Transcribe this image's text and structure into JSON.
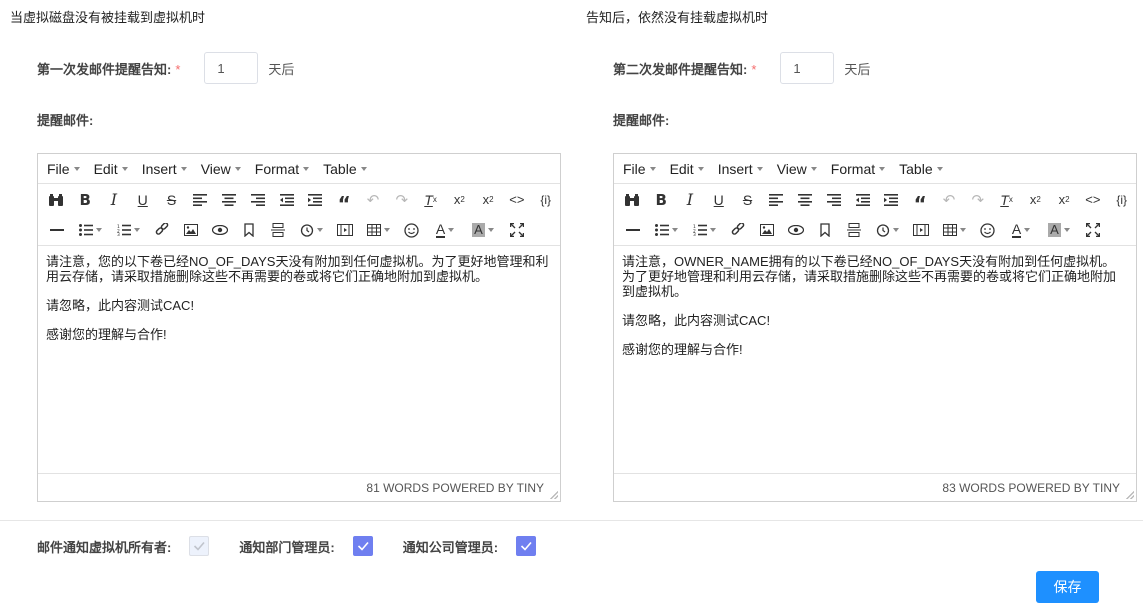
{
  "left": {
    "section_title": "当虚拟磁盘没有被挂载到虚拟机时",
    "reminder_label": "第一次发邮件提醒告知:",
    "required_mark": "*",
    "days_value": "1",
    "days_unit": "天后",
    "mail_label": "提醒邮件:",
    "content": [
      "请注意，您的以下卷已经NO_OF_DAYS天没有附加到任何虚拟机。为了更好地管理和利用云存储，请采取措施删除这些不再需要的卷或将它们正确地附加到虚拟机。",
      "请忽略，此内容测试CAC!",
      "感谢您的理解与合作!"
    ],
    "status": "81 WORDS POWERED BY TINY"
  },
  "right": {
    "section_title": "告知后，依然没有挂载虚拟机时",
    "reminder_label": "第二次发邮件提醒告知:",
    "required_mark": "*",
    "days_value": "1",
    "days_unit": "天后",
    "mail_label": "提醒邮件:",
    "content": [
      "请注意，OWNER_NAME拥有的以下卷已经NO_OF_DAYS天没有附加到任何虚拟机。为了更好地管理和利用云存储，请采取措施删除这些不再需要的卷或将它们正确地附加到虚拟机。",
      "请忽略，此内容测试CAC!",
      "感谢您的理解与合作!"
    ],
    "status": "83 WORDS POWERED BY TINY"
  },
  "editor_menu": [
    "File",
    "Edit",
    "Insert",
    "View",
    "Format",
    "Table"
  ],
  "toolbar_row1": [
    {
      "icon": "find-replace-icon"
    },
    {
      "icon": "bold-icon"
    },
    {
      "icon": "italic-icon"
    },
    {
      "icon": "underline-icon"
    },
    {
      "icon": "strikethrough-icon"
    },
    {
      "icon": "align-left-icon"
    },
    {
      "icon": "align-center-icon"
    },
    {
      "icon": "align-right-icon"
    },
    {
      "icon": "outdent-icon"
    },
    {
      "icon": "indent-icon"
    },
    {
      "icon": "blockquote-icon"
    },
    {
      "icon": "undo-icon"
    },
    {
      "icon": "redo-icon"
    },
    {
      "icon": "clear-format-icon"
    },
    {
      "icon": "subscript-icon"
    },
    {
      "icon": "superscript-icon"
    },
    {
      "icon": "code-icon"
    },
    {
      "icon": "template-icon"
    }
  ],
  "toolbar_row2": [
    {
      "icon": "horizontal-rule-icon"
    },
    {
      "icon": "bullet-list-icon"
    },
    {
      "icon": "numbered-list-icon"
    },
    {
      "icon": "link-icon"
    },
    {
      "icon": "image-icon"
    },
    {
      "icon": "preview-icon"
    },
    {
      "icon": "bookmark-icon"
    },
    {
      "icon": "page-break-icon"
    },
    {
      "icon": "clock-icon"
    },
    {
      "icon": "media-icon"
    },
    {
      "icon": "table-icon"
    },
    {
      "icon": "emoji-icon"
    },
    {
      "icon": "text-color-icon"
    },
    {
      "icon": "background-color-icon"
    },
    {
      "icon": "fullscreen-icon"
    }
  ],
  "notify": {
    "owner_label": "邮件通知虚拟机所有者:",
    "owner_checked": true,
    "owner_disabled": true,
    "dept_label": "通知部门管理员:",
    "dept_checked": true,
    "company_label": "通知公司管理员:",
    "company_checked": true
  },
  "save_label": "保存",
  "colors": {
    "accent": "#1e90ff",
    "checkbox": "#6f7ff0",
    "required": "#f56c6c"
  }
}
